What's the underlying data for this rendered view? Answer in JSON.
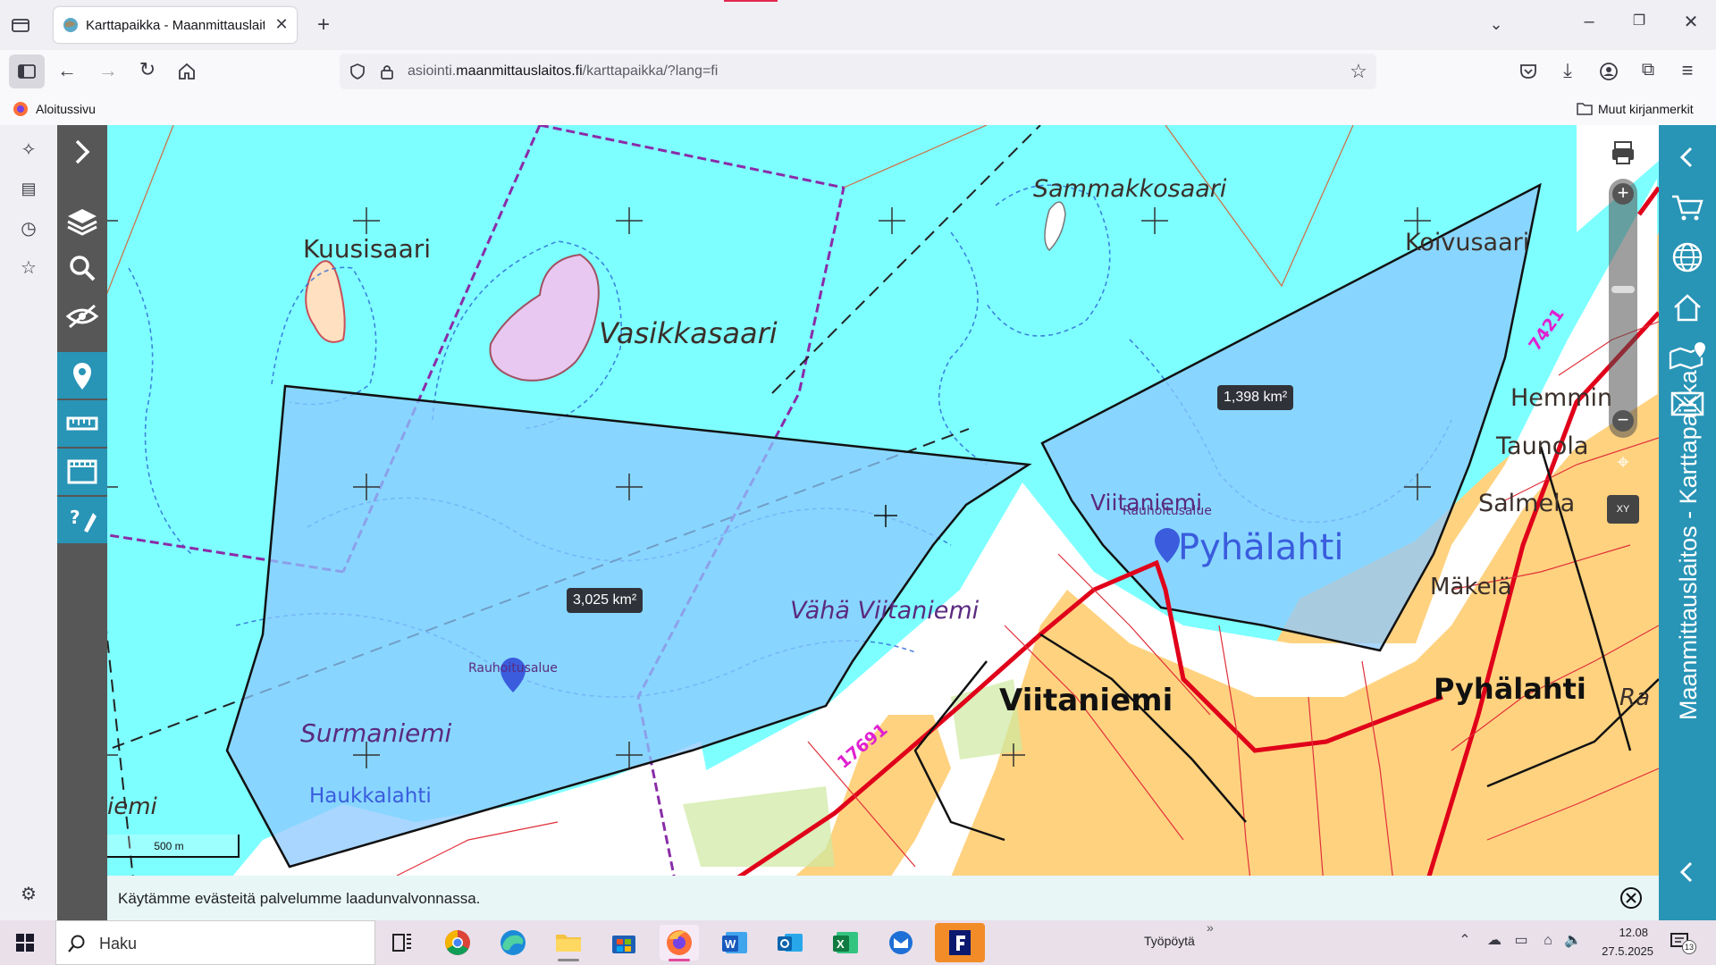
{
  "browser": {
    "tab_title": "Karttapaikka - Maanmittauslaitos",
    "url_prefix": "asiointi.",
    "url_domain": "maanmittauslaitos.fi",
    "url_path": "/karttapaikka/?lang=fi",
    "bookmark_home": "Aloitussivu",
    "bookmark_other": "Muut kirjanmerkit"
  },
  "map": {
    "area_labels": [
      "3,025 km²",
      "1,398 km²"
    ],
    "place_names": {
      "kuusisaari": "Kuusisaari",
      "vasikkasaari": "Vasikkasaari",
      "sammakkosaari": "Sammakkosaari",
      "koivusaari": "Koivusaari",
      "viitaniemi_small": "Viitaniemi",
      "rauhoitusalue": "Rauhoitusalue",
      "pyhalahti_water": "Pyhälahti",
      "vaha_viitaniemi": "Vähä Viitaniemi",
      "viitaniemi_big": "Viitaniemi",
      "surmaniemi": "Surmaniemi",
      "haukkalahti": "Haukkalahti",
      "iemi": "iemi",
      "pyhalahti_village": "Pyhälahti",
      "hemmin": "Hemmin",
      "taunola": "Taunola",
      "salmela": "Salmela",
      "makela": "Mäkelä",
      "ra": "Ra",
      "road_17691": "17691",
      "road_7421": "7421"
    },
    "scale_label": "500 m",
    "xy_label": "XY"
  },
  "side": {
    "title": "Maanmittauslaitos - Karttapaikka"
  },
  "cookie": {
    "text": "Käytämme evästeitä palvelumme laadunvalvonnassa."
  },
  "taskbar": {
    "search_placeholder": "Haku",
    "desktop_label": "Työpöytä",
    "time": "12.08",
    "date": "27.5.2025",
    "notification_count": "13"
  },
  "colors": {
    "water": "#7effff",
    "land_orange": "#ffd27f",
    "measure_fill": "#8cc8ff",
    "accent_teal": "#2894b6",
    "road_red": "#e0001a",
    "protected_purple": "#8a2ca8"
  }
}
